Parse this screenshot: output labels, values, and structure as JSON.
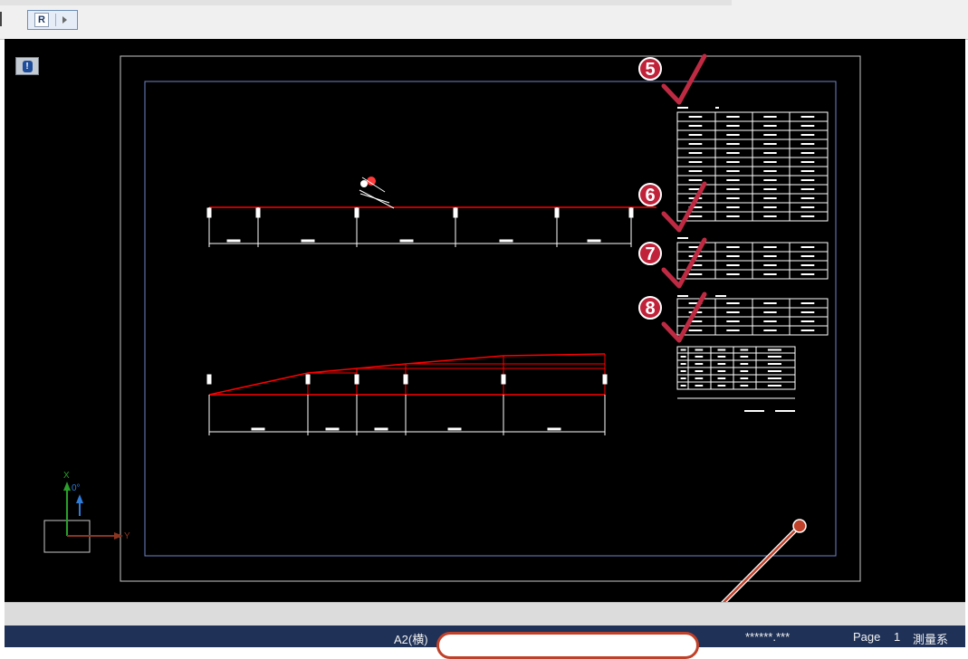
{
  "toolbar": {
    "r_button_label": "R",
    "arrow_label": "▸"
  },
  "canvas": {
    "info_button_label": "!",
    "axis_x_label": "X",
    "axis_y_label": "Y",
    "axis_angle_label": "0°"
  },
  "markers": [
    {
      "number": "5"
    },
    {
      "number": "6"
    },
    {
      "number": "7"
    },
    {
      "number": "8"
    }
  ],
  "status": {
    "paper": "A2(横)",
    "coords": "******.***",
    "page_label": "Page",
    "page_number": "1",
    "system": "測量系"
  },
  "colors": {
    "canvas_background": "#000000",
    "drawing_red": "#ff0000",
    "sheet_frame": "#c8c8c8",
    "inner_frame": "#6f84c6",
    "marker_red": "#c0223a",
    "status_bar": "#1f3157",
    "callout_border": "#c0412a"
  }
}
